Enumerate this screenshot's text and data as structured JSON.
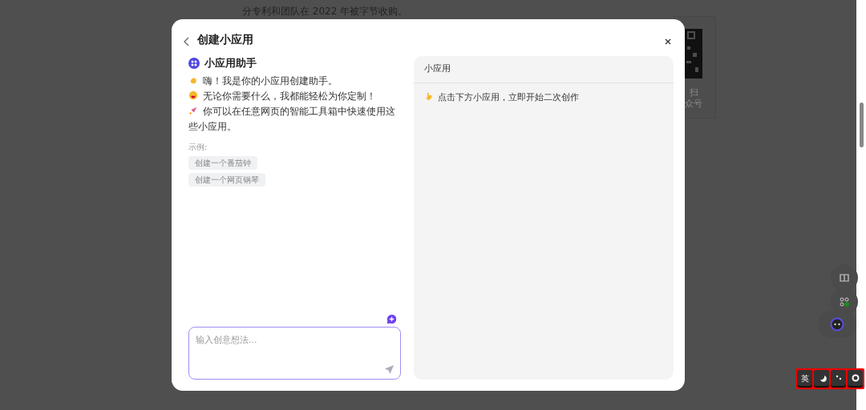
{
  "background": {
    "text": "分专利和团队在 2022 年被字节收购。",
    "qr_caption": [
      "扫",
      "众号"
    ]
  },
  "dialog": {
    "title": "创建小应用",
    "assistant": {
      "name": "小应用助手",
      "lines": [
        "嗨！我是你的小应用创建助手。",
        "无论你需要什么，我都能轻松为你定制！",
        "你可以在任意网页的智能工具箱中快速使用这些小应用。"
      ],
      "examples_label": "示例:",
      "examples": [
        "创建一个番茄钟",
        "创建一个网页钢琴"
      ]
    },
    "input": {
      "placeholder": "输入创意想法..."
    },
    "panel": {
      "title": "小应用",
      "hint": "点击下方小应用，立即开始二次创作"
    }
  },
  "toolbar": {
    "language_key": "英"
  }
}
